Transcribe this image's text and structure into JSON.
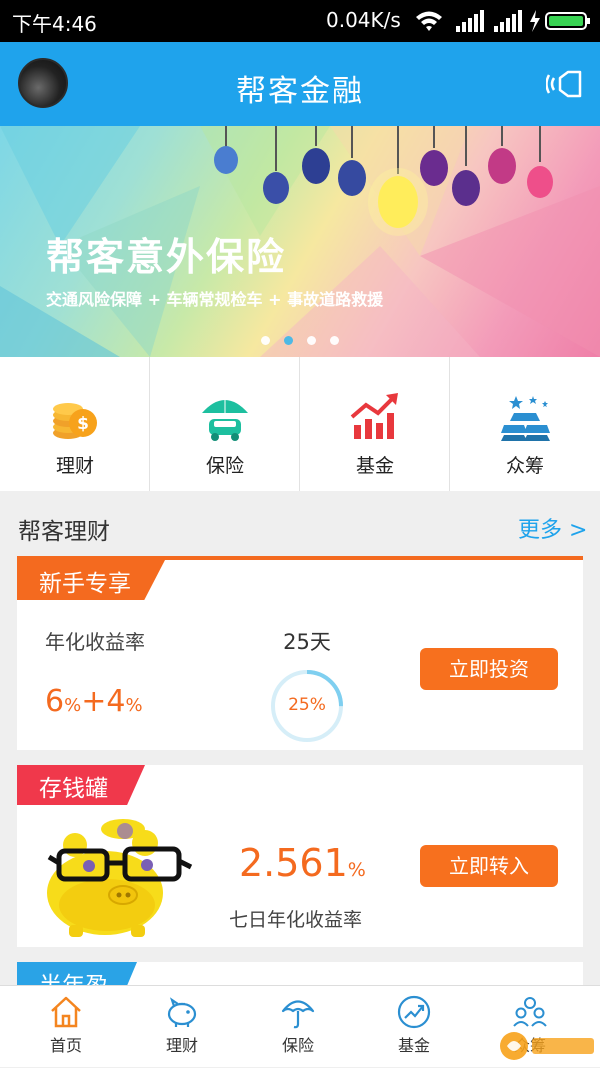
{
  "status_bar": {
    "time": "下午4:46",
    "network_speed": "0.04K/s"
  },
  "header": {
    "title": "帮客金融",
    "bg_color": "#1fa3ec"
  },
  "banner": {
    "title": "帮客意外保险",
    "subtitle": "交通风险保障 + 车辆常规检车 + 事故道路救援",
    "page_count": 4,
    "active_page": 2
  },
  "categories": [
    {
      "label": "理财",
      "icon": "coins-icon"
    },
    {
      "label": "保险",
      "icon": "umbrella-car-icon"
    },
    {
      "label": "基金",
      "icon": "rising-chart-icon"
    },
    {
      "label": "众筹",
      "icon": "gold-bars-icon"
    }
  ],
  "section": {
    "title": "帮客理财",
    "more": "更多 >"
  },
  "newbie_card": {
    "tag": "新手专享",
    "rate_label": "年化收益率",
    "rate_base": "6",
    "rate_unit": "%",
    "rate_plus": "+4",
    "rate_unit2": "%",
    "duration": "25天",
    "progress_text": "25%",
    "progress": 0.25,
    "button": "立即投资"
  },
  "piggy_card": {
    "tag": "存钱罐",
    "rate_value": "2.561",
    "rate_unit": "%",
    "rate_label": "七日年化收益率",
    "button": "立即转入"
  },
  "half_year_card": {
    "tag": "半年盈"
  },
  "bottom_nav": [
    {
      "label": "首页",
      "icon": "home-icon"
    },
    {
      "label": "理财",
      "icon": "piggy-bank-icon"
    },
    {
      "label": "保险",
      "icon": "umbrella-icon"
    },
    {
      "label": "基金",
      "icon": "trend-icon"
    },
    {
      "label": "众筹",
      "icon": "people-icon"
    }
  ],
  "colors": {
    "accent_orange": "#f46a1f",
    "accent_red": "#f0384b",
    "accent_blue": "#1fa3ec"
  }
}
